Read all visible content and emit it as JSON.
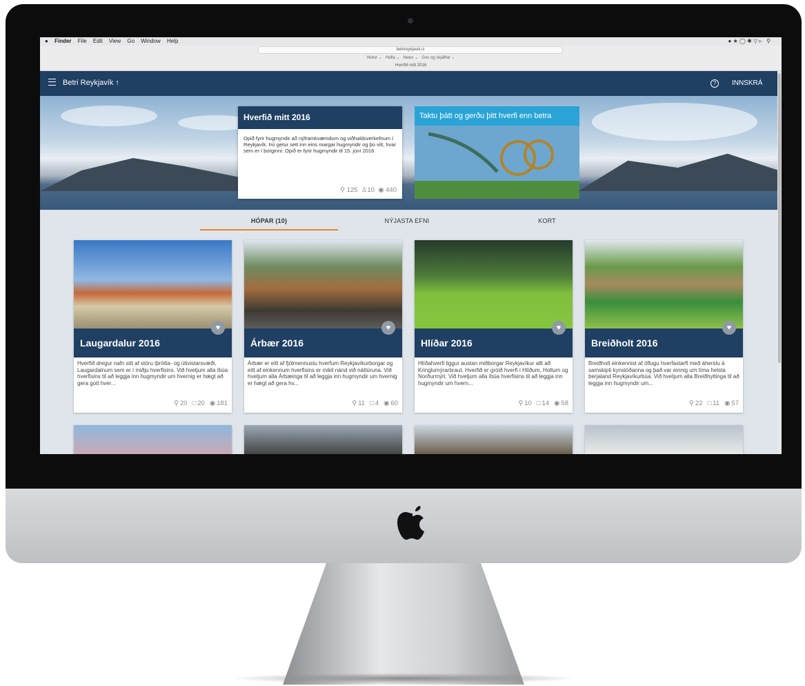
{
  "menubar": {
    "items": [
      "Finder",
      "File",
      "Edit",
      "View",
      "Go",
      "Window",
      "Help"
    ]
  },
  "browser": {
    "url": "betrireykjavik.is",
    "favorites": [
      "Veður ⌄",
      "Hafla ⌄",
      "News ⌄",
      "Gos og skjálftar ⌄"
    ],
    "tab_title": "Hverfið mitt 2016"
  },
  "app": {
    "title": "Betri Reykjavík",
    "login": "INNSKRÁ"
  },
  "hero": {
    "card_title": "Hverfið mitt 2016",
    "card_text": "Opið fyrir hugmyndir að nýframkvæmdum og viðhaldsverkefnum í Reykjavík. Þú getur sett inn eins margar hugmyndir og þú vilt, hvar sem er í borginni. Opið er fyrir hugmyndir til 15. júní 2016",
    "stats": {
      "ideas": "125",
      "groups": "10",
      "views": "440"
    },
    "promo_title": "Taktu þátt og gerðu þitt hverfi enn betra"
  },
  "tabs": [
    "HÓPAR (10)",
    "NÝJASTA EFNI",
    "KORT"
  ],
  "cards": [
    {
      "title": "Laugardalur 2016",
      "desc": "Hverfið dregur nafn sitt af stóru íþrótta- og útivistarsvæði, Laugardalnum sem er í miðju hverfisins. Við hvetjum alla íbúa hverfisins til að leggja inn hugmyndir um hvernig er hægt að gera gott hver...",
      "ideas": "20",
      "comments": "20",
      "views": "181"
    },
    {
      "title": "Árbær 2016",
      "desc": "Árbær er eitt af fjölmennustu hverfum Reykjavíkurborgar og eitt af einkennum hverfisins er mikil nánd við náttúruna. Við hvetjum alla Árbæinga til að leggja inn hugmyndir um hvernig er hægt að gera hv...",
      "ideas": "11",
      "comments": "4",
      "views": "60"
    },
    {
      "title": "Hlíðar 2016",
      "desc": "Hlíðahverfi liggur austan miðborgar Reykjavíkur allt að Kringlumýrarbraut. Hverfið er gróið hverfi í Hlíðum, Holtum og Norðurmýri. Við hvetjum alla íbúa hverfisins til að leggja inn hugmyndir um hvern...",
      "ideas": "10",
      "comments": "14",
      "views": "58"
    },
    {
      "title": "Breiðholt 2016",
      "desc": "Breiðholt einkennist af öflugu hverfastarfi með áherslu á samskipti kynslóðanna og það var einnig um tíma helsta berjaland Reykjavíkurbúa. Við hvetjum alla Breiðhyltinga til að leggja inn hugmyndir um...",
      "ideas": "22",
      "comments": "11",
      "views": "57"
    }
  ],
  "colors": {
    "appbar": "#1f3f63",
    "accent": "#e4832d",
    "promo": "#2aa4d6"
  }
}
